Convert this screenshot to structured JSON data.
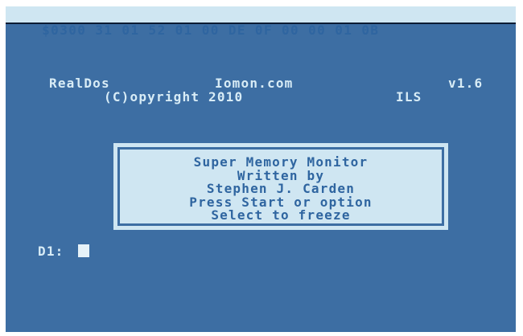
{
  "status_bar": {
    "text": "$0300 31 01 52 01 00 DE 0F 00 00 01 0B"
  },
  "header": {
    "product": "RealDos",
    "site": "Iomon.com",
    "version": "v1.6",
    "copyright": "(C)opyright 2010",
    "maker": "ILS"
  },
  "dialog": {
    "lines": [
      "Super Memory Monitor",
      "Written by",
      "Stephen J. Carden",
      "Press Start or option",
      "Select to freeze"
    ]
  },
  "prompt": {
    "text": "D1:"
  },
  "colors": {
    "background": "#3d6ea3",
    "panel": "#cfe6f2",
    "text_light": "#d8ecf6",
    "text_dark": "#2f65a0"
  }
}
